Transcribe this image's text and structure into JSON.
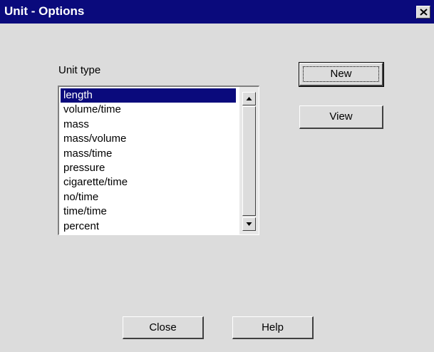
{
  "window": {
    "title": "Unit - Options",
    "colors": {
      "titlebar": "#0a0a7c",
      "face": "#dcdcdc",
      "selection": "#0a0a7c"
    }
  },
  "unit_type": {
    "label": "Unit type",
    "selected_index": 0,
    "items": [
      "length",
      "volume/time",
      "mass",
      "mass/volume",
      "mass/time",
      "pressure",
      "cigarette/time",
      "no/time",
      "time/time",
      "percent"
    ]
  },
  "buttons": {
    "new_label": "New",
    "view_label": "View",
    "close_label": "Close",
    "help_label": "Help"
  },
  "icons": {
    "close": "close-icon",
    "scroll_up": "arrow-up-icon",
    "scroll_down": "arrow-down-icon"
  }
}
